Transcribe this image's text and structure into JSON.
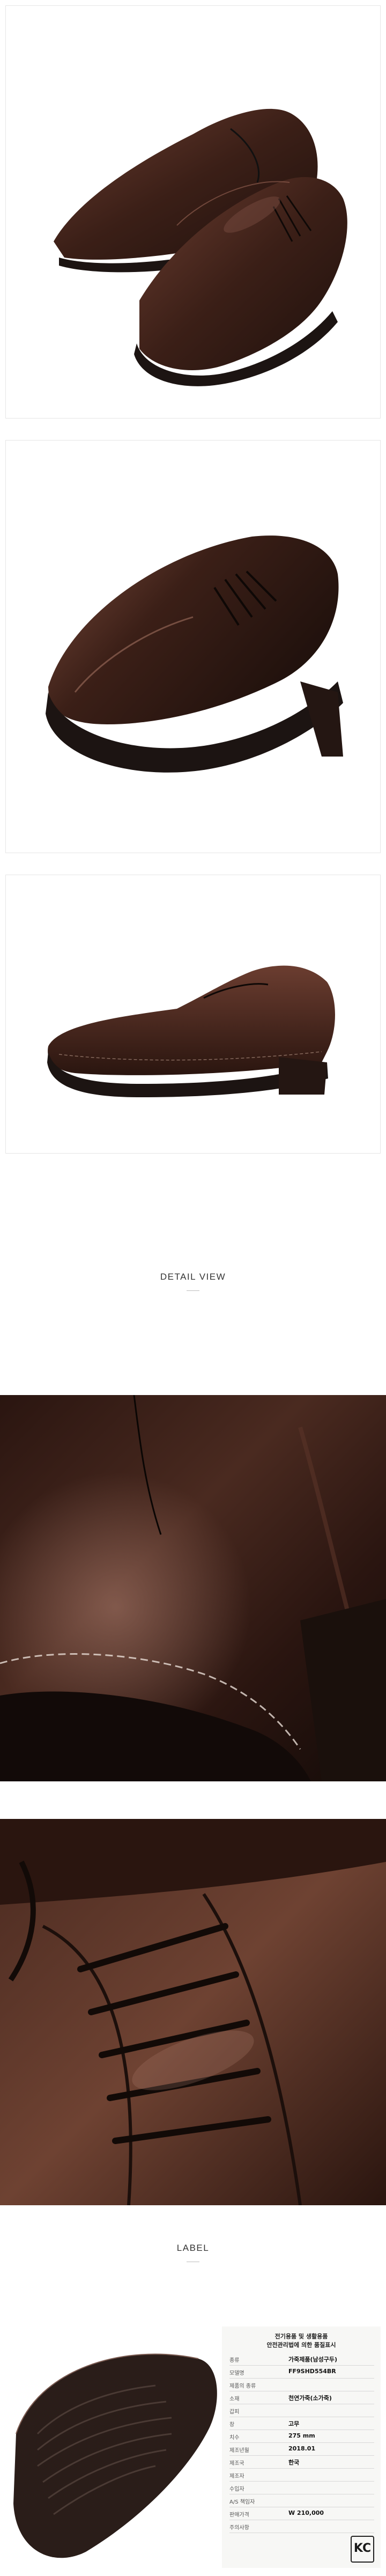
{
  "sections": {
    "detail_title": "DETAIL VIEW",
    "label_title": "LABEL"
  },
  "label": {
    "title_line1": "전기용품 및 생활용품",
    "title_line2": "안전관리법에 의한 품질표시",
    "rows": [
      {
        "key": "종류",
        "value": "가죽제품(남성구두)"
      },
      {
        "key": "모델명",
        "value": "FF9SHD554BR"
      },
      {
        "key": "제품의 종류",
        "value": ""
      },
      {
        "key": "소재",
        "value": "천연가죽(소가죽)"
      },
      {
        "key": "갑피",
        "value": ""
      },
      {
        "key": "창",
        "value": "고무"
      },
      {
        "key": "치수",
        "value": "275 mm"
      },
      {
        "key": "제조년월",
        "value": "2018.01"
      },
      {
        "key": "제조국",
        "value": "한국"
      },
      {
        "key": "제조자",
        "value": ""
      },
      {
        "key": "수입자",
        "value": ""
      },
      {
        "key": "A/S 책임자",
        "value": ""
      },
      {
        "key": "판매가격",
        "value": "W 210,000"
      },
      {
        "key": "주의사항",
        "value": ""
      }
    ],
    "kc_mark": "KC"
  },
  "colors": {
    "leather": "#3b1f17",
    "leather_highlight": "#8a5a4c",
    "sole": "#1c1412",
    "background": "#ffffff"
  }
}
